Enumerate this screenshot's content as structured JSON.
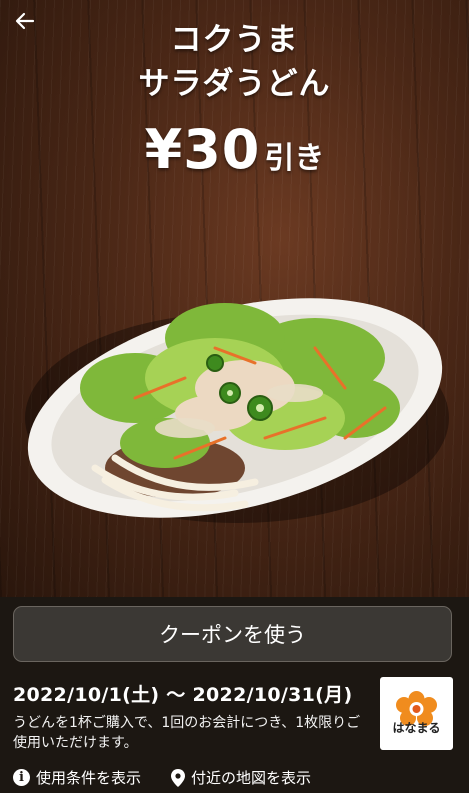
{
  "header": {
    "back_icon": "arrow-left-icon",
    "title_line1": "コクうま",
    "title_line2": "サラダうどん",
    "discount_amount": "¥30",
    "discount_suffix": "引き"
  },
  "coupon": {
    "use_button_label": "クーポンを使う",
    "valid_period": "2022/10/1(土) 〜 2022/10/31(月)",
    "description": "うどんを1杯ご購入で、1回のお会計につき、1枚限りご使用いただけます。"
  },
  "brand": {
    "logo_text": "はなまる",
    "accent_color": "#f08c1e"
  },
  "links": {
    "terms_label": "使用条件を表示",
    "terms_icon": "info-icon",
    "map_label": "付近の地図を表示",
    "map_icon": "map-pin-icon"
  }
}
